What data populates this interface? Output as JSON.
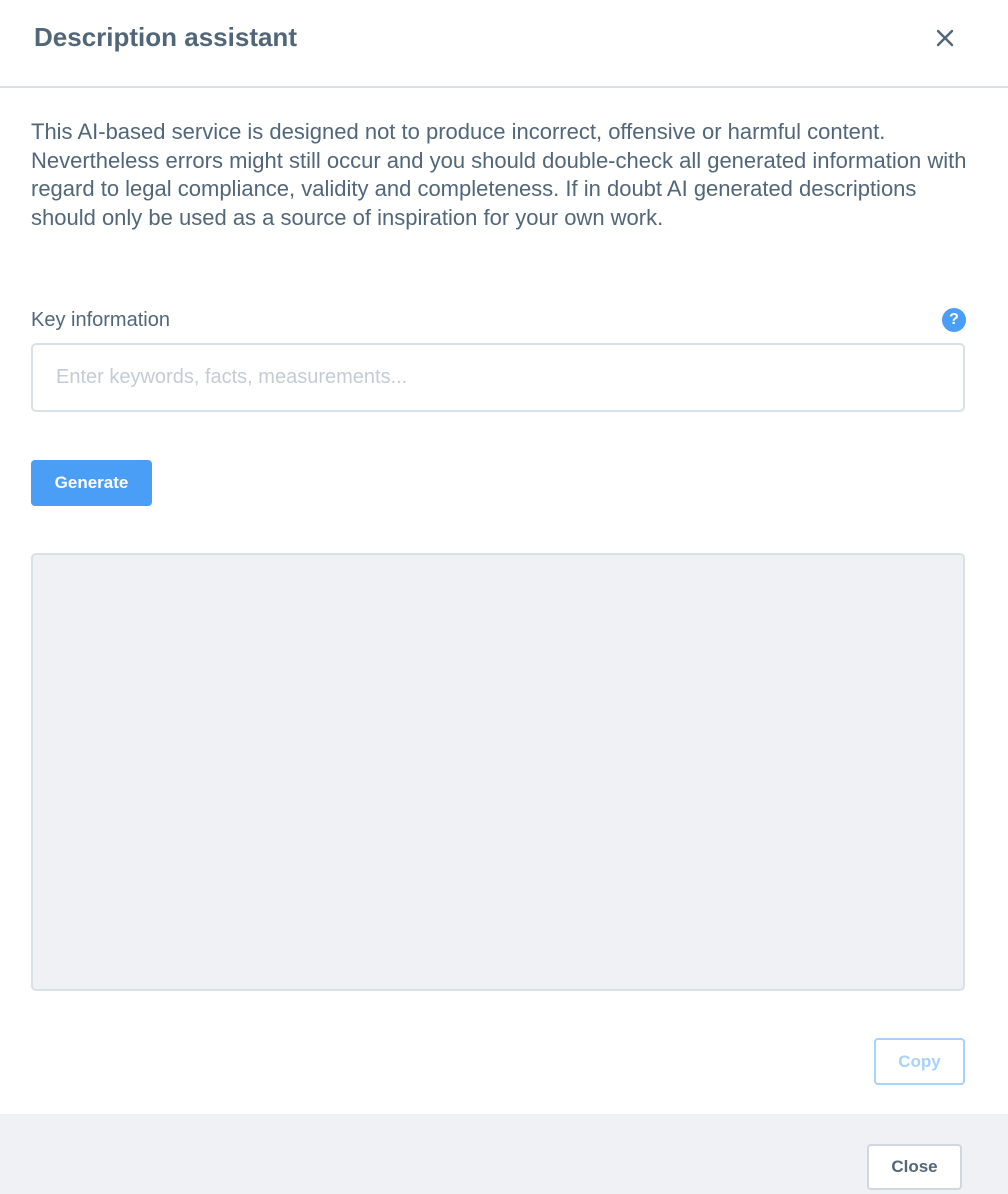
{
  "header": {
    "title": "Description assistant",
    "close_icon": "close-icon"
  },
  "disclaimer": {
    "text": "This AI-based service is designed not to produce incorrect, offensive or harmful content. Nevertheless errors might still occur and you should double-check all generated information with regard to legal compliance, validity and completeness. If in doubt AI generated descriptions should only be used as a source of inspiration for your own work."
  },
  "key_information": {
    "label": "Key information",
    "help_icon": "help-icon",
    "help_glyph": "?",
    "placeholder": "Enter keywords, facts, measurements...",
    "value": ""
  },
  "actions": {
    "generate_label": "Generate",
    "copy_label": "Copy"
  },
  "output": {
    "value": ""
  },
  "footer": {
    "close_label": "Close"
  },
  "colors": {
    "accent": "#4a9ef6",
    "text": "#52667a",
    "border": "#d9e1e8",
    "muted_background": "#eff1f4",
    "disabled_accent": "#a9d1fb"
  }
}
